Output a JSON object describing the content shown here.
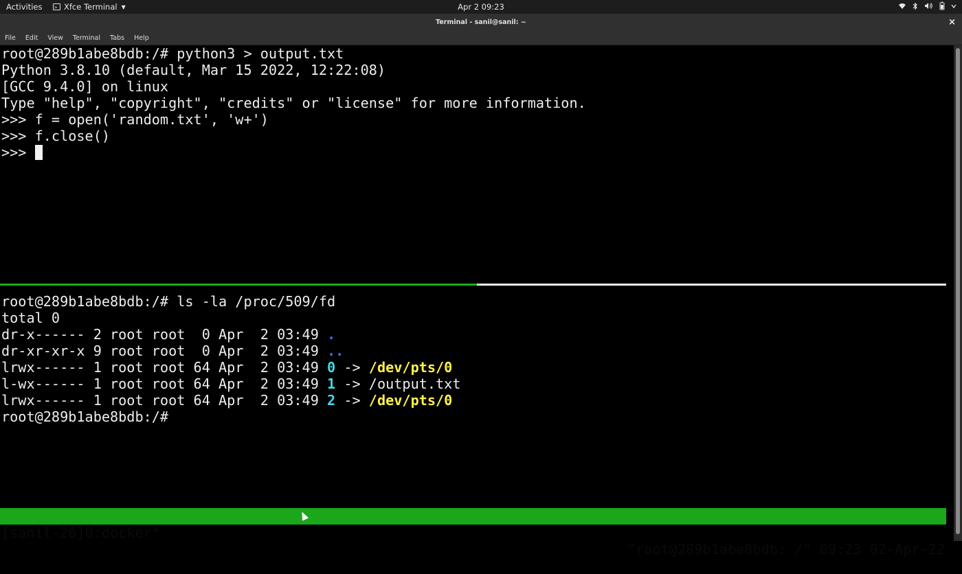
{
  "topbar": {
    "activities": "Activities",
    "app_name": "Xfce Terminal",
    "clock": "Apr 2  09:23",
    "tray_icons": [
      "wifi-icon",
      "bluetooth-icon",
      "volume-icon",
      "battery-icon",
      "power-icon"
    ]
  },
  "window": {
    "title": "Terminal - sanil@sanil: ~",
    "close": "×"
  },
  "menu": {
    "items": [
      "File",
      "Edit",
      "View",
      "Terminal",
      "Tabs",
      "Help"
    ]
  },
  "pane_top": {
    "lines": [
      "root@289b1abe8bdb:/# python3 > output.txt",
      "Python 3.8.10 (default, Mar 15 2022, 12:22:08)",
      "[GCC 9.4.0] on linux",
      "Type \"help\", \"copyright\", \"credits\" or \"license\" for more information.",
      ">>> f = open('random.txt', 'w+')",
      ">>> f.close()"
    ],
    "prompt": ">>> "
  },
  "pane_bottom": {
    "command": "root@289b1abe8bdb:/# ls -la /proc/509/fd",
    "total": "total 0",
    "entries": [
      {
        "meta": "dr-x------ 2 root root  0 Apr  2 03:49 ",
        "name": ".",
        "arrow": "",
        "target": ""
      },
      {
        "meta": "dr-xr-xr-x 9 root root  0 Apr  2 03:49 ",
        "name": "..",
        "arrow": "",
        "target": ""
      },
      {
        "meta": "lrwx------ 1 root root 64 Apr  2 03:49 ",
        "name": "0",
        "arrow": " -> ",
        "target": "/dev/pts/0"
      },
      {
        "meta": "l-wx------ 1 root root 64 Apr  2 03:49 ",
        "name": "1",
        "arrow": " -> ",
        "target": "/output.txt"
      },
      {
        "meta": "lrwx------ 1 root root 64 Apr  2 03:49 ",
        "name": "2",
        "arrow": " -> ",
        "target": "/dev/pts/0"
      }
    ],
    "prompt": "root@289b1abe8bdb:/# "
  },
  "tmux_status": {
    "left": "[sanil-26]0:docker*",
    "right": "\"root@289b1abe8bdb: /\" 09:23 02-Apr-22"
  },
  "colors": {
    "status_bg": "#1aa81a",
    "dir_name": "#4f6bff",
    "fd_number": "#3fd9e6",
    "pts_target": "#fff24a"
  }
}
